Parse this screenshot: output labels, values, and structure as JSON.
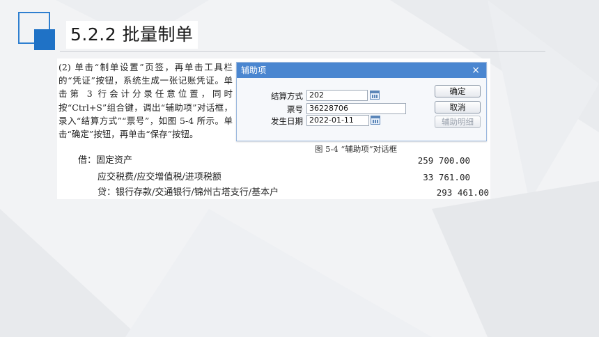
{
  "slide": {
    "title": "5.2.2  批量制单"
  },
  "instruction": {
    "text": "(2) 单击“制单设置”页签，再单击工具栏的“凭证”按钮，系统生成一张记账凭证。单击第 3 行会计分录任意位置，同时按“Ctrl+S”组合键，调出“辅助项”对话框，录入“结算方式”“票号”，如图 5-4 所示。单击“确定”按钮，再单击“保存”按钮。"
  },
  "dialog": {
    "title": "辅助项",
    "close_glyph": "×",
    "fields": [
      {
        "label": "结算方式",
        "value": "202"
      },
      {
        "label": "票号",
        "value": "36228706"
      },
      {
        "label": "发生日期",
        "value": "2022-01-11"
      }
    ],
    "buttons": {
      "ok": "确定",
      "cancel": "取消",
      "detail": "辅助明细"
    },
    "icons": [
      "calendar-icon",
      "lookup-icon"
    ]
  },
  "caption": "图 5-4 “辅助项”对话框",
  "entries": [
    {
      "label": "借：固定资产",
      "amount": "259 700.00"
    },
    {
      "label": "应交税费/应交增值税/进项税额",
      "amount": "33 761.00"
    },
    {
      "label": "贷：银行存款/交通银行/锦州古塔支行/基本户",
      "amount": "293 461.00"
    }
  ],
  "colors": {
    "accent": "#1f72c6",
    "dialog_title_bar": "#4a86d0",
    "background": "#f2f3f5"
  }
}
